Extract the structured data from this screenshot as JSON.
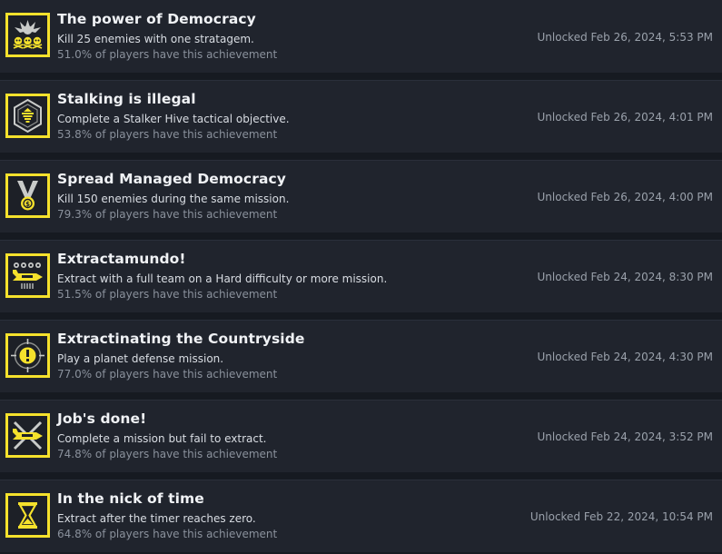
{
  "achievements": [
    {
      "title": "The power of Democracy",
      "description": "Kill 25 enemies with one stratagem.",
      "percent": "51.0% of players have this achievement",
      "unlocked": "Unlocked Feb 26, 2024, 5:53 PM",
      "icon": "explosion-skulls-icon"
    },
    {
      "title": "Stalking is illegal",
      "description": "Complete a Stalker Hive tactical objective.",
      "percent": "53.8% of players have this achievement",
      "unlocked": "Unlocked Feb 26, 2024, 4:01 PM",
      "icon": "hive-hexagon-icon"
    },
    {
      "title": "Spread Managed Democracy",
      "description": "Kill 150 enemies during the same mission.",
      "percent": "79.3% of players have this achievement",
      "unlocked": "Unlocked Feb 26, 2024, 4:00 PM",
      "icon": "medal-icon"
    },
    {
      "title": "Extractamundo!",
      "description": "Extract with a full team on a Hard difficulty or more mission.",
      "percent": "51.5% of players have this achievement",
      "unlocked": "Unlocked Feb 24, 2024, 8:30 PM",
      "icon": "dropship-squad-icon"
    },
    {
      "title": "Extractinating the Countryside",
      "description": "Play a planet defense mission.",
      "percent": "77.0% of players have this achievement",
      "unlocked": "Unlocked Feb 24, 2024, 4:30 PM",
      "icon": "defense-target-icon"
    },
    {
      "title": "Job's done!",
      "description": "Complete a mission but fail to extract.",
      "percent": "74.8% of players have this achievement",
      "unlocked": "Unlocked Feb 24, 2024, 3:52 PM",
      "icon": "crossed-dropship-icon"
    },
    {
      "title": "In the nick of time",
      "description": "Extract after the timer reaches zero.",
      "percent": "64.8% of players have this achievement",
      "unlocked": "Unlocked Feb 22, 2024, 10:54 PM",
      "icon": "hourglass-icon"
    }
  ],
  "colors": {
    "page_background": "#161a21",
    "row_background": "#20242d",
    "icon_accent": "#f5e12c",
    "title_text": "#f0f2f5",
    "description_text": "#d9dde3",
    "percent_text": "#8a919c",
    "date_text": "#9aa1ab"
  }
}
